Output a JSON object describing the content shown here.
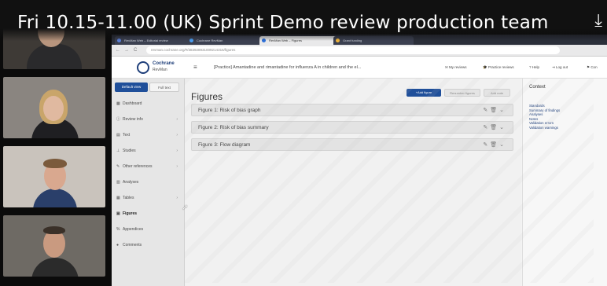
{
  "video": {
    "title": "Fri 10.15-11.00 (UK) Sprint Demo review production team",
    "download_glyph": "⤓"
  },
  "participants": [
    {
      "label": "participant-1"
    },
    {
      "label": "participant-2"
    },
    {
      "label": "participant-3"
    },
    {
      "label": "participant-4"
    }
  ],
  "browser": {
    "tabs": [
      {
        "label": "RevMan Web – Editorial review",
        "color": "#5b7fd6"
      },
      {
        "label": "Cochrane RevMan",
        "color": "#4a9df0"
      },
      {
        "label": "RevMan Web – Figures",
        "color": "#2d6fd8"
      },
      {
        "label": "Grant funding",
        "color": "#f0b43c"
      }
    ],
    "address": "revman.cochrane.org/#/383928931009214316/figures",
    "nav_back": "←",
    "nav_forward": "→",
    "nav_reload": "C"
  },
  "app": {
    "logo_name": "Cochrane",
    "logo_sub": "RevMan",
    "menu_glyph": "≡",
    "review_title": "[Practice] Amantadine and rimantadine for influenza A in children and the el...",
    "header_nav": [
      {
        "icon": "✉",
        "label": "My reviews"
      },
      {
        "icon": "🎓",
        "label": "Practice reviews"
      },
      {
        "icon": "?",
        "label": "Help"
      },
      {
        "icon": "⇥",
        "label": "Log out"
      },
      {
        "icon": "⚑",
        "label": "Con"
      }
    ]
  },
  "sidebar": {
    "view_default": "Default view",
    "view_full": "Full text",
    "items": [
      {
        "icon": "▦",
        "label": "Dashboard",
        "chevron": ""
      },
      {
        "icon": "ⓘ",
        "label": "Review info",
        "chevron": "›"
      },
      {
        "icon": "▤",
        "label": "Text",
        "chevron": "›"
      },
      {
        "icon": "⊥",
        "label": "Studies",
        "chevron": "›"
      },
      {
        "icon": "✎",
        "label": "Other references",
        "chevron": "›"
      },
      {
        "icon": "▥",
        "label": "Analyses",
        "chevron": ""
      },
      {
        "icon": "▦",
        "label": "Tables",
        "chevron": "›"
      },
      {
        "icon": "▣",
        "label": "Figures",
        "chevron": ""
      },
      {
        "icon": "%",
        "label": "Appendices",
        "chevron": ""
      },
      {
        "icon": "●",
        "label": "Comments",
        "chevron": ""
      }
    ],
    "active_item": "Figures"
  },
  "main": {
    "title": "Figures",
    "add_figure": "+Add figure",
    "renumber": "Renumber figures",
    "add_note": "Add note",
    "figures": [
      {
        "label": "Figure 1: Risk of bias graph",
        "actions": "✎🗑⌄"
      },
      {
        "label": "Figure 2: Risk of bias summary",
        "actions": "✎🗑⌄"
      },
      {
        "label": "Figure 3: Flow diagram",
        "actions": "✎🗑⌄"
      }
    ]
  },
  "context": {
    "title": "Context",
    "links": [
      "Standards",
      "Summary of findings",
      "Analyses",
      "Notes",
      "Validation errors",
      "Validation warnings"
    ]
  },
  "colors": {
    "accent": "#1f3f7a",
    "primary_button": "#1f4f9a",
    "sidebar_bg": "#e6e6e6"
  }
}
